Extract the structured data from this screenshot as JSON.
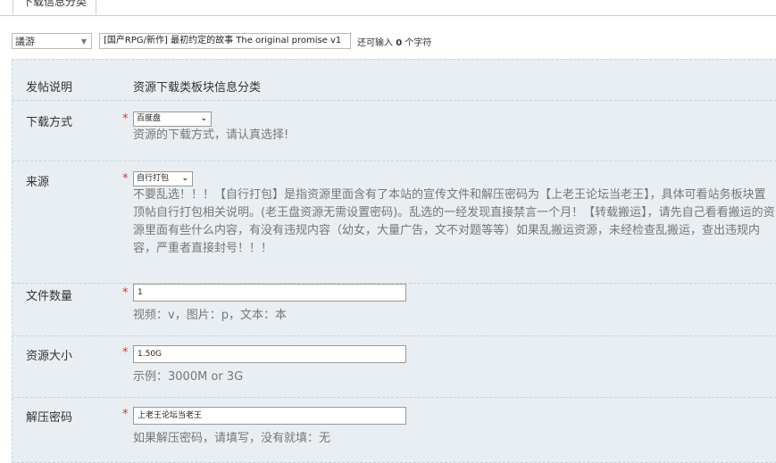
{
  "tab": {
    "label": "下载信息分类"
  },
  "toolbar": {
    "type_select": "議游",
    "title_value": "[国产RPG/新作] 最初约定的故事 The original promise v1",
    "remain_prefix": "还可输入 ",
    "remain_count": "0",
    "remain_suffix": " 个字符"
  },
  "form": {
    "intro": {
      "label": "发帖说明",
      "value": "资源下载类板块信息分类"
    },
    "download_method": {
      "label": "下载方式",
      "required": "*",
      "value": "百度盘",
      "help": "资源的下载方式，请认真选择!"
    },
    "source": {
      "label": "来源",
      "required": "*",
      "value": "自行打包",
      "help": "不要乱选！！！【自行打包】是指资源里面含有了本站的宣传文件和解压密码为【上老王论坛当老王】，具体可看站务板块置顶帖自行打包相关说明。(老王盘资源无需设置密码)。乱选的一经发现直接禁言一个月！【转载搬运】，请先自己看看搬运的资源里面有些什么内容，有没有违规内容（幼女，大量广告，文不对题等等）如果乱搬运资源，未经检查乱搬运，查出违规内容，严重者直接封号！！！"
    },
    "file_count": {
      "label": "文件数量",
      "required": "*",
      "value": "1",
      "help": "视频：v，图片：p，文本：本"
    },
    "size": {
      "label": "资源大小",
      "required": "*",
      "value": "1.50G",
      "help": "示例：3000M or 3G"
    },
    "password": {
      "label": "解压密码",
      "required": "*",
      "value": "上老王论坛当老王",
      "help": "如果解压密码，请填写，没有就填：无"
    }
  },
  "icons": {
    "dropdown": "chevron-down-icon"
  }
}
